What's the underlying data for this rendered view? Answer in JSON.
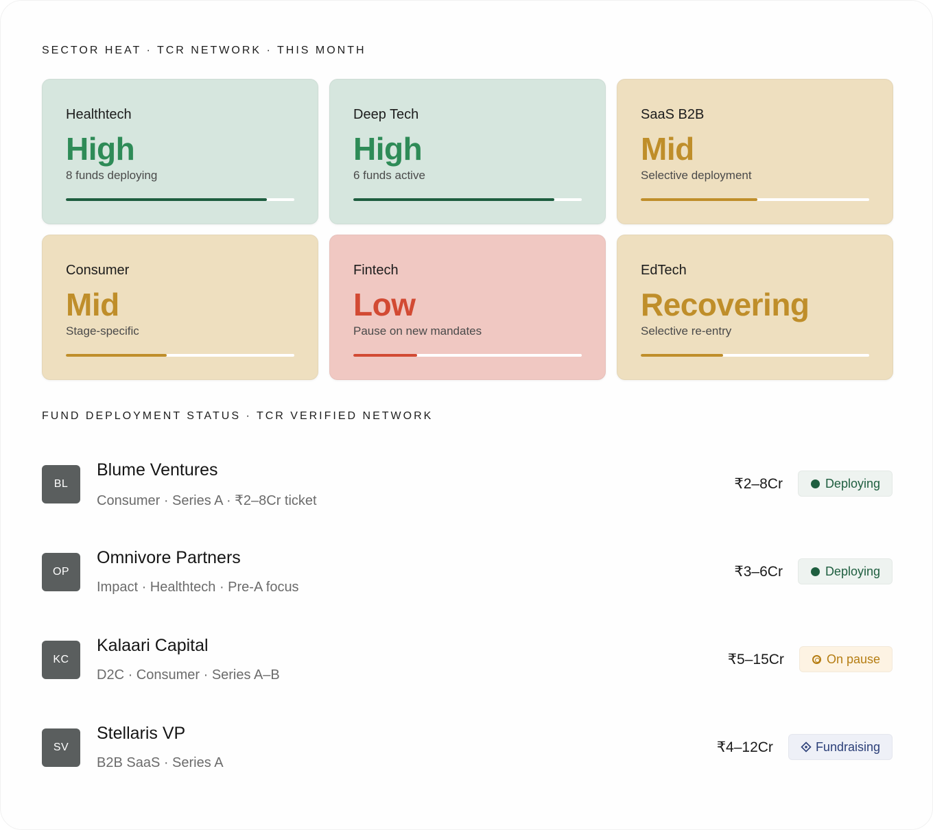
{
  "sector_section": {
    "title": "SECTOR HEAT · TCR NETWORK · THIS MONTH",
    "cards": [
      {
        "sector": "Healthtech",
        "level": "High",
        "note": "8 funds deploying",
        "heat": 0.88,
        "bg": "#d6e6de",
        "level_color": "#2e8b57",
        "bar_color": "#1e5e3f"
      },
      {
        "sector": "Deep Tech",
        "level": "High",
        "note": "6 funds active",
        "heat": 0.88,
        "bg": "#d6e6de",
        "level_color": "#2e8b57",
        "bar_color": "#1e5e3f"
      },
      {
        "sector": "SaaS B2B",
        "level": "Mid",
        "note": "Selective deployment",
        "heat": 0.51,
        "bg": "#eedfbf",
        "level_color": "#bf8e2a",
        "bar_color": "#bf8e2a"
      },
      {
        "sector": "Consumer",
        "level": "Mid",
        "note": "Stage-specific",
        "heat": 0.44,
        "bg": "#eedfbf",
        "level_color": "#bf8e2a",
        "bar_color": "#bf8e2a"
      },
      {
        "sector": "Fintech",
        "level": "Low",
        "note": "Pause on new mandates",
        "heat": 0.28,
        "bg": "#f0c8c2",
        "level_color": "#d24a33",
        "bar_color": "#d24a33"
      },
      {
        "sector": "EdTech",
        "level": "Recovering",
        "note": "Selective re-entry",
        "heat": 0.36,
        "bg": "#eedfbf",
        "level_color": "#bf8e2a",
        "bar_color": "#bf8e2a"
      }
    ]
  },
  "funds_section": {
    "title": "FUND DEPLOYMENT STATUS · TCR VERIFIED NETWORK",
    "funds": [
      {
        "initials": "BL",
        "name": "Blume Ventures",
        "meta": "Consumer · Series A · ₹2–8Cr ticket",
        "ticket": "₹2–8Cr",
        "status": "Deploying",
        "status_icon": "filled-dot-icon",
        "status_bg": "#eef3f0",
        "status_color": "#1e5e3f"
      },
      {
        "initials": "OP",
        "name": "Omnivore Partners",
        "meta": "Impact · Healthtech · Pre-A focus",
        "ticket": "₹3–6Cr",
        "status": "Deploying",
        "status_icon": "filled-dot-icon",
        "status_bg": "#eef3f0",
        "status_color": "#1e5e3f"
      },
      {
        "initials": "KC",
        "name": "Kalaari Capital",
        "meta": "D2C · Consumer · Series A–B",
        "ticket": "₹5–15Cr",
        "status": "On pause",
        "status_icon": "pause-ring-icon",
        "status_bg": "#fdf3e3",
        "status_color": "#b57d12"
      },
      {
        "initials": "SV",
        "name": "Stellaris VP",
        "meta": "B2B SaaS · Series A",
        "ticket": "₹4–12Cr",
        "status": "Fundraising",
        "status_icon": "diamond-icon",
        "status_bg": "#eef0f7",
        "status_color": "#2b3f78"
      }
    ]
  }
}
